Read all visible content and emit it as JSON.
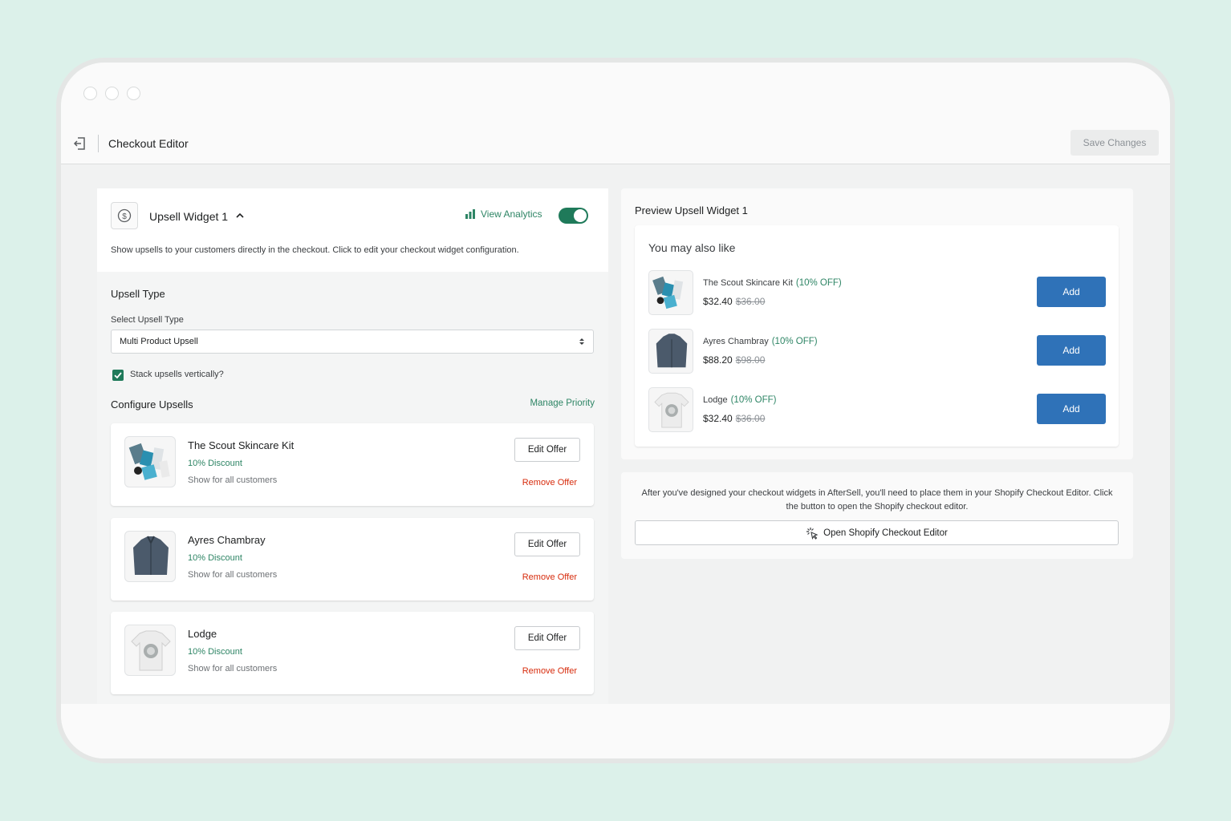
{
  "header": {
    "title": "Checkout Editor",
    "save_label": "Save Changes"
  },
  "widget": {
    "title": "Upsell Widget 1",
    "analytics_label": "View Analytics",
    "enabled": true,
    "description": "Show upsells to your customers directly in the checkout. Click to edit your checkout widget configuration."
  },
  "upsell_type": {
    "section_title": "Upsell Type",
    "select_label": "Select Upsell Type",
    "selected_value": "Multi Product Upsell",
    "stack_label": "Stack upsells vertically?",
    "stack_checked": true
  },
  "configure": {
    "section_title": "Configure Upsells",
    "manage_label": "Manage Priority",
    "offers": [
      {
        "name": "The Scout Skincare Kit",
        "discount": "10% Discount",
        "audience": "Show for all customers",
        "edit_label": "Edit Offer",
        "remove_label": "Remove Offer"
      },
      {
        "name": "Ayres Chambray",
        "discount": "10% Discount",
        "audience": "Show for all customers",
        "edit_label": "Edit Offer",
        "remove_label": "Remove Offer"
      },
      {
        "name": "Lodge",
        "discount": "10% Discount",
        "audience": "Show for all customers",
        "edit_label": "Edit Offer",
        "remove_label": "Remove Offer"
      }
    ]
  },
  "preview": {
    "title": "Preview Upsell Widget 1",
    "heading": "You may also like",
    "items": [
      {
        "name": "The Scout Skincare Kit",
        "off": "(10% OFF)",
        "price": "$32.40",
        "old_price": "$36.00",
        "add_label": "Add"
      },
      {
        "name": "Ayres Chambray",
        "off": "(10% OFF)",
        "price": "$88.20",
        "old_price": "$98.00",
        "add_label": "Add"
      },
      {
        "name": "Lodge",
        "off": "(10% OFF)",
        "price": "$32.40",
        "old_price": "$36.00",
        "add_label": "Add"
      }
    ]
  },
  "info": {
    "text": "After you've designed your checkout widgets in AfterSell, you'll need to place them in your Shopify Checkout Editor. Click the button to open the Shopify checkout editor.",
    "button_label": "Open Shopify Checkout Editor"
  },
  "colors": {
    "accent_green": "#1f7a5a",
    "link_green": "#2e8565",
    "primary_blue": "#2f72b8",
    "danger": "#d72c0d",
    "background": "#dcf1ea"
  }
}
